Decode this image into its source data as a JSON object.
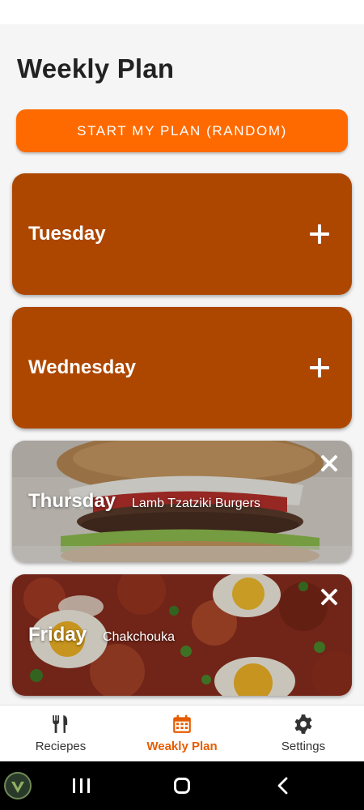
{
  "page": {
    "title": "Weekly Plan"
  },
  "start_button": {
    "label": "START MY PLAN (RANDOM)"
  },
  "days": [
    {
      "day": "Tuesday",
      "meal": null,
      "action_icon": "plus-icon"
    },
    {
      "day": "Wednesday",
      "meal": null,
      "action_icon": "plus-icon"
    },
    {
      "day": "Thursday",
      "meal": "Lamb Tzatziki Burgers",
      "action_icon": "close-icon"
    },
    {
      "day": "Friday",
      "meal": "Chakchouka",
      "action_icon": "close-icon"
    }
  ],
  "bottom_nav": {
    "items": [
      {
        "label": "Reciepes",
        "icon": "fork-knife-icon",
        "active": false
      },
      {
        "label": "Weakly Plan",
        "icon": "calendar-icon",
        "active": true
      },
      {
        "label": "Settings",
        "icon": "gear-icon",
        "active": false
      }
    ]
  },
  "colors": {
    "accent": "#ff6a00",
    "card": "#ad4700",
    "active_nav": "#e65c00"
  }
}
